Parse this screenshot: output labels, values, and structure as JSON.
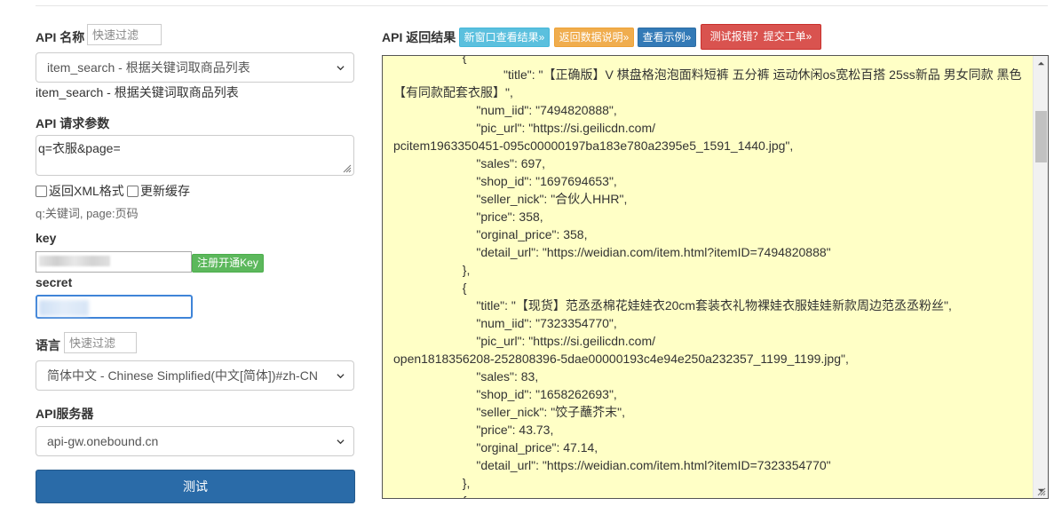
{
  "api_name": {
    "label": "API 名称",
    "filter_placeholder": "快速过滤",
    "selected": "item_search - 根据关键词取商品列表",
    "display": "item_search - 根据关键词取商品列表"
  },
  "params": {
    "label": "API 请求参数",
    "value": "q=衣服&page=",
    "xml_label": "返回XML格式",
    "cache_label": "更新缓存",
    "hint": "q:关键词, page:页码"
  },
  "key": {
    "label": "key",
    "register_button": "注册开通Key"
  },
  "secret": {
    "label": "secret"
  },
  "language": {
    "label": "语言",
    "filter_placeholder": "快速过滤",
    "selected": "简体中文 - Chinese Simplified(中文[简体])#zh-CN"
  },
  "server": {
    "label": "API服务器",
    "selected": "api-gw.onebound.cn"
  },
  "test_button": "测试",
  "result": {
    "label": "API 返回结果",
    "buttons": {
      "new_window": "新窗口查看结果»",
      "data_doc": "返回数据说明»",
      "example": "查看示例»",
      "report": "测试报错？提交工单»"
    },
    "lines": [
      "                    {",
      "                        \"title\": \"【正确版】V 棋盘格泡泡面料短裤 五分裤 运动休闲os宽松百搭 25ss新品 男女同款 黑色【有同款配套衣服】\",",
      "                        \"num_iid\": \"7494820888\",",
      "                        \"pic_url\": \"https://si.geilicdn.com/",
      "pcitem1963350451-095c00000197ba183e780a2395e5_1591_1440.jpg\",",
      "                        \"sales\": 697,",
      "                        \"shop_id\": \"1697694653\",",
      "                        \"seller_nick\": \"合伙人HHR\",",
      "                        \"price\": 358,",
      "                        \"orginal_price\": 358,",
      "                        \"detail_url\": \"https://weidian.com/item.html?itemID=7494820888\"",
      "                    },",
      "                    {",
      "                        \"title\": \"【现货】范丞丞棉花娃娃衣20cm套装衣礼物裸娃衣服娃娃新款周边范丞丞粉丝\",",
      "                        \"num_iid\": \"7323354770\",",
      "                        \"pic_url\": \"https://si.geilicdn.com/",
      "open1818356208-252808396-5dae00000193c4e94e250a232357_1199_1199.jpg\",",
      "                        \"sales\": 83,",
      "                        \"shop_id\": \"1658262693\",",
      "                        \"seller_nick\": \"饺子蘸芥末\",",
      "                        \"price\": 43.73,",
      "                        \"orginal_price\": 47.14,",
      "                        \"detail_url\": \"https://weidian.com/item.html?itemID=7323354770\"",
      "                    },",
      "                    {"
    ]
  },
  "colors": {
    "btn_info": "#5bc0de",
    "btn_warning": "#f0ad4e",
    "btn_primary": "#337ab7",
    "btn_danger": "#d9534f",
    "btn_success": "#5cb85c",
    "result_bg": "#ffffc6"
  }
}
